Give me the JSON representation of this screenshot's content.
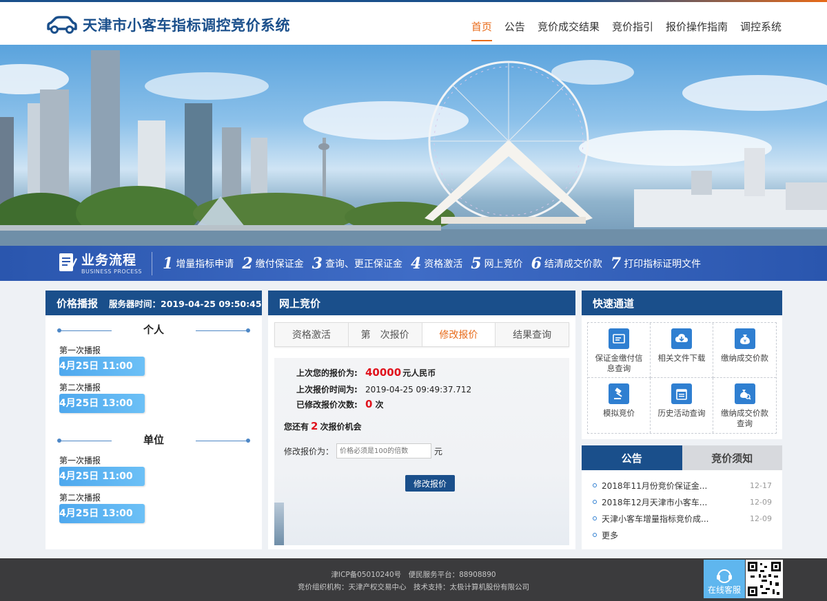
{
  "header": {
    "title": "天津市小客车指标调控竞价系统",
    "nav": [
      "首页",
      "公告",
      "竞价成交结果",
      "竞价指引",
      "报价操作指南",
      "调控系统"
    ],
    "active_nav": "首页"
  },
  "process": {
    "title": "业务流程",
    "subtitle": "BUSINESS PROCESS",
    "steps": [
      {
        "num": "1",
        "label": "增量指标申请"
      },
      {
        "num": "2",
        "label": "缴付保证金"
      },
      {
        "num": "3",
        "label": "查询、更正保证金"
      },
      {
        "num": "4",
        "label": "资格激活"
      },
      {
        "num": "5",
        "label": "网上竞价"
      },
      {
        "num": "6",
        "label": "结清成交价款"
      },
      {
        "num": "7",
        "label": "打印指标证明文件"
      }
    ]
  },
  "price_broadcast": {
    "title": "价格播报",
    "server_time_label": "服务器时间：",
    "server_time": "2019-04-25 09:50:45",
    "personal": {
      "title": "个人",
      "first_label": "第一次播报",
      "first_time": "4月25日 11:00",
      "second_label": "第二次播报",
      "second_time": "4月25日 13:00"
    },
    "company": {
      "title": "单位",
      "first_label": "第一次播报",
      "first_time": "4月25日 11:00",
      "second_label": "第二次播报",
      "second_time": "4月25日 13:00"
    }
  },
  "online_bid": {
    "title": "网上竞价",
    "tabs": [
      "资格激活",
      "第　次报价",
      "修改报价",
      "结果查询"
    ],
    "active_tab": "修改报价",
    "last_price_label": "上次您的报价为:",
    "last_price": "40000",
    "last_price_unit": "元人民币",
    "last_time_label": "上次报价时间为:",
    "last_time": "2019-04-25 09:49:37.712",
    "modify_count_label": "已修改报价次数:",
    "modify_count": "0",
    "modify_count_unit": "次",
    "chance_prefix": "您还有",
    "chance_num": "2",
    "chance_suffix": "次报价机会",
    "modify_label": "修改报价为：",
    "modify_placeholder": "价格必须是100的倍数",
    "modify_unit": "元",
    "modify_button": "修改报价"
  },
  "quick_access": {
    "title": "快速通道",
    "items": [
      {
        "label": "保证金缴付信息查询",
        "icon": "card-icon"
      },
      {
        "label": "相关文件下载",
        "icon": "cloud-download-icon"
      },
      {
        "label": "缴纳成交价款",
        "icon": "money-bag-icon"
      },
      {
        "label": "模拟竞价",
        "icon": "gavel-icon"
      },
      {
        "label": "历史活动查询",
        "icon": "calendar-icon"
      },
      {
        "label": "缴纳成交价款查询",
        "icon": "money-search-icon"
      }
    ]
  },
  "notice": {
    "tabs": [
      "公告",
      "竞价须知"
    ],
    "active_tab": "公告",
    "items": [
      {
        "title": "2018年11月份竞价保证金...",
        "date": "12-17"
      },
      {
        "title": "2018年12月天津市小客车...",
        "date": "12-09"
      },
      {
        "title": "天津小客车增量指标竞价成...",
        "date": "12-09"
      }
    ],
    "more": "更多"
  },
  "footer": {
    "line1": "津ICP备05010240号　便民服务平台：88908890",
    "line2": "竞价组织机构：天津产权交易中心　技术支持：太极计算机股份有限公司",
    "online_service": "在线客服"
  },
  "colors": {
    "primary": "#1a4f8b",
    "accent": "#e86a18",
    "highlight_red": "#e0131d",
    "pill_blue": "#4ea8ee"
  }
}
